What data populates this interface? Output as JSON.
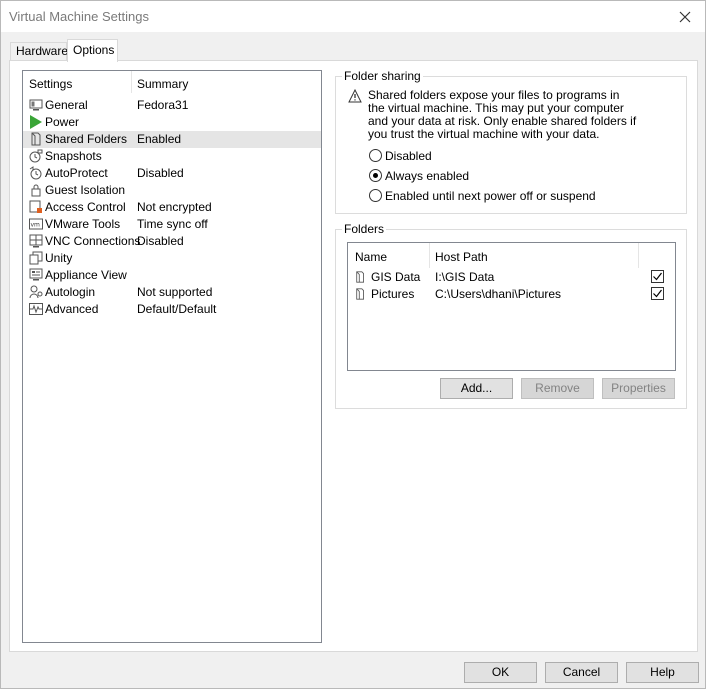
{
  "window": {
    "title": "Virtual Machine Settings"
  },
  "tabs": [
    {
      "label": "Hardware",
      "active": false
    },
    {
      "label": "Options",
      "active": true
    }
  ],
  "settings": {
    "col_settings": "Settings",
    "col_summary": "Summary",
    "items": [
      {
        "label": "General",
        "summary": "Fedora31",
        "icon": "general-icon"
      },
      {
        "label": "Power",
        "summary": "",
        "icon": "power-play-icon"
      },
      {
        "label": "Shared Folders",
        "summary": "Enabled",
        "icon": "shared-folders-icon",
        "selected": true
      },
      {
        "label": "Snapshots",
        "summary": "",
        "icon": "snapshots-icon"
      },
      {
        "label": "AutoProtect",
        "summary": "Disabled",
        "icon": "autoprotect-icon"
      },
      {
        "label": "Guest Isolation",
        "summary": "",
        "icon": "lock-icon"
      },
      {
        "label": "Access Control",
        "summary": "Not encrypted",
        "icon": "access-control-icon"
      },
      {
        "label": "VMware Tools",
        "summary": "Time sync off",
        "icon": "vmware-tools-icon"
      },
      {
        "label": "VNC Connections",
        "summary": "Disabled",
        "icon": "vnc-icon"
      },
      {
        "label": "Unity",
        "summary": "",
        "icon": "unity-icon"
      },
      {
        "label": "Appliance View",
        "summary": "",
        "icon": "appliance-view-icon"
      },
      {
        "label": "Autologin",
        "summary": "Not supported",
        "icon": "autologin-icon"
      },
      {
        "label": "Advanced",
        "summary": "Default/Default",
        "icon": "advanced-icon"
      }
    ]
  },
  "folder_sharing": {
    "title": "Folder sharing",
    "warning": "Shared folders expose your files to programs in the virtual machine. This may put your computer and your data at risk. Only enable shared folders if you trust the virtual machine with your data.",
    "options": [
      {
        "label": "Disabled",
        "checked": false
      },
      {
        "label": "Always enabled",
        "checked": true
      },
      {
        "label": "Enabled until next power off or suspend",
        "checked": false
      }
    ]
  },
  "folders": {
    "title": "Folders",
    "col_name": "Name",
    "col_host_path": "Host Path",
    "rows": [
      {
        "name": "GIS Data",
        "path": "I:\\GIS Data",
        "enabled": true
      },
      {
        "name": "Pictures",
        "path": "C:\\Users\\dhani\\Pictures",
        "enabled": true
      }
    ],
    "add_label": "Add...",
    "remove_label": "Remove",
    "properties_label": "Properties"
  },
  "footer": {
    "ok_label": "OK",
    "cancel_label": "Cancel",
    "help_label": "Help"
  }
}
